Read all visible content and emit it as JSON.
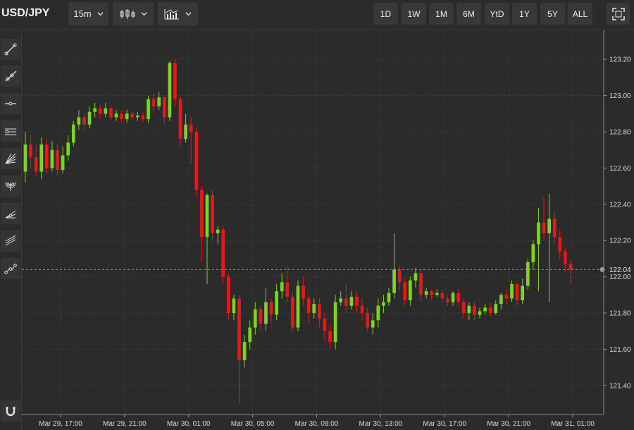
{
  "header": {
    "symbol": "USD/JPY",
    "interval": "15m",
    "chart_style_icon": "candlestick-icon",
    "indicators_icon": "indicator-chart-icon",
    "ranges": [
      "1D",
      "1W",
      "1M",
      "6M",
      "YtD",
      "1Y",
      "5Y",
      "ALL"
    ],
    "fullscreen_icon": "fullscreen-icon"
  },
  "tools": [
    "trend-line-icon",
    "ray-icon",
    "horizontal-line-icon",
    "parallel-channel-icon",
    "fan-icon",
    "arc-icon",
    "pitchfork-icon",
    "channels-icon",
    "path-icon"
  ],
  "bottom_tool": "magnet-icon",
  "colors": {
    "up": "#7ed321",
    "down": "#e3191c",
    "background": "#2a2b2a",
    "grid": "#3b3c3b"
  },
  "chart_data": {
    "type": "candlestick",
    "title": "",
    "x_tick_labels": [
      "Mar 29, 17:00",
      "Mar 29, 21:00",
      "Mar 30, 01:00",
      "Mar 30, 05:00",
      "Mar 30, 09:00",
      "Mar 30, 13:00",
      "Mar 30, 17:00",
      "Mar 30, 21:00",
      "Mar 31, 01:00"
    ],
    "y_tick_labels": [
      "121.40",
      "121.60",
      "121.80",
      "122.00",
      "122.20",
      "122.40",
      "122.60",
      "122.80",
      "123.00",
      "123.20"
    ],
    "y_ticks": [
      121.4,
      121.6,
      121.8,
      122.0,
      122.2,
      122.4,
      122.6,
      122.8,
      123.0,
      123.2
    ],
    "ylim": [
      121.24,
      123.36
    ],
    "grid": true,
    "last_price": 122.04,
    "last_price_label": "122.04",
    "candles": [
      [
        122.58,
        122.73,
        122.8,
        122.52
      ],
      [
        122.73,
        122.66,
        122.78,
        122.6
      ],
      [
        122.66,
        122.58,
        122.73,
        122.55
      ],
      [
        122.58,
        122.73,
        122.77,
        122.54
      ],
      [
        122.73,
        122.6,
        122.76,
        122.57
      ],
      [
        122.6,
        122.7,
        122.75,
        122.58
      ],
      [
        122.7,
        122.59,
        122.73,
        122.56
      ],
      [
        122.59,
        122.67,
        122.72,
        122.57
      ],
      [
        122.67,
        122.74,
        122.78,
        122.64
      ],
      [
        122.74,
        122.84,
        122.86,
        122.72
      ],
      [
        122.84,
        122.88,
        122.92,
        122.81
      ],
      [
        122.88,
        122.84,
        122.9,
        122.8
      ],
      [
        122.84,
        122.91,
        122.94,
        122.82
      ],
      [
        122.91,
        122.93,
        122.96,
        122.88
      ],
      [
        122.93,
        122.9,
        122.95,
        122.87
      ],
      [
        122.9,
        122.93,
        122.96,
        122.88
      ],
      [
        122.93,
        122.88,
        122.95,
        122.86
      ],
      [
        122.88,
        122.9,
        122.92,
        122.86
      ],
      [
        122.9,
        122.87,
        122.92,
        122.85
      ],
      [
        122.87,
        122.9,
        122.92,
        122.85
      ],
      [
        122.9,
        122.88,
        122.91,
        122.86
      ],
      [
        122.88,
        122.89,
        122.91,
        122.86
      ],
      [
        122.89,
        122.87,
        122.91,
        122.85
      ],
      [
        122.87,
        122.98,
        123.0,
        122.85
      ],
      [
        122.98,
        122.94,
        123.01,
        122.9
      ],
      [
        122.94,
        122.99,
        123.02,
        122.92
      ],
      [
        122.99,
        122.88,
        123.0,
        122.84
      ],
      [
        122.88,
        123.18,
        123.19,
        122.86
      ],
      [
        123.18,
        122.98,
        123.2,
        122.94
      ],
      [
        122.98,
        122.76,
        123.0,
        122.72
      ],
      [
        122.76,
        122.84,
        122.9,
        122.74
      ],
      [
        122.84,
        122.8,
        122.88,
        122.62
      ],
      [
        122.8,
        122.48,
        122.82,
        122.44
      ],
      [
        122.48,
        122.22,
        122.5,
        122.08
      ],
      [
        122.22,
        122.45,
        122.46,
        121.96
      ],
      [
        122.45,
        122.24,
        122.48,
        122.2
      ],
      [
        122.24,
        122.26,
        122.28,
        122.18
      ],
      [
        122.26,
        122.0,
        122.28,
        121.96
      ],
      [
        122.0,
        121.8,
        122.02,
        121.76
      ],
      [
        121.8,
        121.88,
        121.9,
        121.76
      ],
      [
        121.88,
        121.54,
        121.9,
        121.3
      ],
      [
        121.54,
        121.64,
        121.68,
        121.5
      ],
      [
        121.64,
        121.72,
        121.76,
        121.6
      ],
      [
        121.72,
        121.82,
        121.86,
        121.68
      ],
      [
        121.82,
        121.74,
        121.84,
        121.7
      ],
      [
        121.74,
        121.86,
        121.94,
        121.7
      ],
      [
        121.86,
        121.79,
        121.88,
        121.74
      ],
      [
        121.79,
        121.92,
        121.96,
        121.76
      ],
      [
        121.92,
        121.97,
        122.02,
        121.88
      ],
      [
        121.97,
        121.89,
        122.06,
        121.86
      ],
      [
        121.89,
        121.72,
        121.92,
        121.7
      ],
      [
        121.72,
        121.95,
        121.98,
        121.7
      ],
      [
        121.95,
        121.88,
        122.0,
        121.84
      ],
      [
        121.88,
        121.8,
        121.9,
        121.74
      ],
      [
        121.8,
        121.85,
        121.88,
        121.77
      ],
      [
        121.85,
        121.77,
        121.88,
        121.72
      ],
      [
        121.77,
        121.7,
        121.8,
        121.64
      ],
      [
        121.7,
        121.64,
        121.74,
        121.6
      ],
      [
        121.64,
        121.86,
        121.9,
        121.6
      ],
      [
        121.86,
        121.88,
        121.92,
        121.84
      ],
      [
        121.88,
        121.84,
        121.96,
        121.8
      ],
      [
        121.84,
        121.89,
        121.92,
        121.82
      ],
      [
        121.89,
        121.84,
        121.92,
        121.8
      ],
      [
        121.84,
        121.8,
        121.88,
        121.76
      ],
      [
        121.8,
        121.72,
        121.83,
        121.7
      ],
      [
        121.72,
        121.76,
        121.8,
        121.68
      ],
      [
        121.76,
        121.84,
        121.88,
        121.72
      ],
      [
        121.84,
        121.86,
        121.9,
        121.8
      ],
      [
        121.86,
        121.91,
        121.94,
        121.84
      ],
      [
        121.91,
        122.04,
        122.24,
        121.88
      ],
      [
        122.04,
        121.97,
        122.06,
        121.92
      ],
      [
        121.97,
        121.87,
        121.99,
        121.84
      ],
      [
        121.87,
        121.98,
        122.0,
        121.84
      ],
      [
        121.98,
        122.02,
        122.05,
        121.94
      ],
      [
        122.02,
        121.9,
        122.04,
        121.86
      ],
      [
        121.9,
        121.92,
        121.94,
        121.88
      ],
      [
        121.92,
        121.9,
        121.93,
        121.87
      ],
      [
        121.9,
        121.91,
        121.93,
        121.89
      ],
      [
        121.91,
        121.88,
        121.93,
        121.86
      ],
      [
        121.88,
        121.86,
        121.9,
        121.84
      ],
      [
        121.86,
        121.91,
        121.92,
        121.84
      ],
      [
        121.91,
        121.86,
        121.93,
        121.84
      ],
      [
        121.86,
        121.8,
        121.88,
        121.77
      ],
      [
        121.8,
        121.84,
        121.86,
        121.76
      ],
      [
        121.84,
        121.79,
        121.86,
        121.76
      ],
      [
        121.79,
        121.81,
        121.83,
        121.77
      ],
      [
        121.81,
        121.83,
        121.85,
        121.79
      ],
      [
        121.83,
        121.8,
        121.86,
        121.78
      ],
      [
        121.8,
        121.85,
        121.87,
        121.79
      ],
      [
        121.85,
        121.9,
        121.91,
        121.82
      ],
      [
        121.9,
        121.88,
        121.93,
        121.85
      ],
      [
        121.88,
        121.96,
        121.98,
        121.86
      ],
      [
        121.96,
        121.87,
        121.97,
        121.84
      ],
      [
        121.87,
        121.95,
        121.99,
        121.85
      ],
      [
        121.95,
        122.08,
        122.1,
        121.93
      ],
      [
        122.08,
        122.18,
        122.2,
        122.04
      ],
      [
        122.18,
        122.3,
        122.38,
        121.92
      ],
      [
        122.3,
        122.24,
        122.44,
        122.2
      ],
      [
        122.24,
        122.32,
        122.46,
        121.86
      ],
      [
        122.32,
        122.22,
        122.36,
        122.18
      ],
      [
        122.22,
        122.14,
        122.26,
        122.1
      ],
      [
        122.14,
        122.07,
        122.16,
        122.03
      ],
      [
        122.07,
        122.04,
        122.09,
        121.96
      ]
    ]
  }
}
